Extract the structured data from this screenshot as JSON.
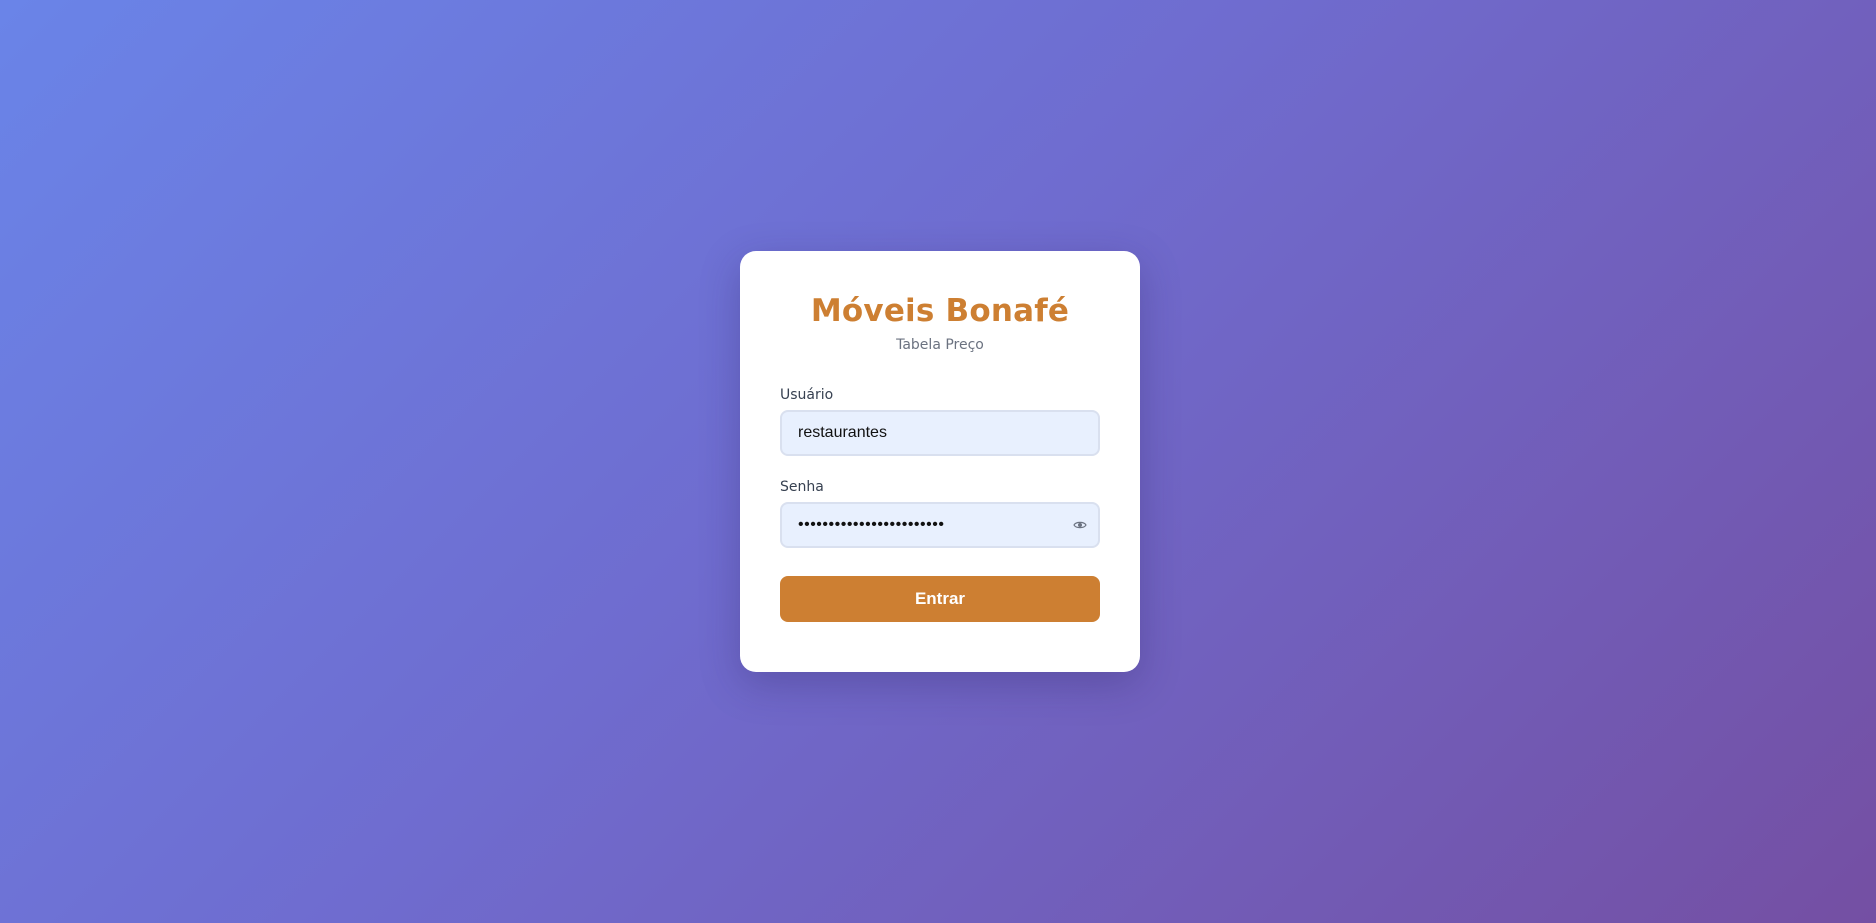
{
  "login": {
    "title": "Móveis Bonafé",
    "subtitle": "Tabela Preço",
    "username": {
      "label": "Usuário",
      "value": "restaurantes"
    },
    "password": {
      "label": "Senha",
      "value": "restaurantes12345678abcd",
      "toggle_icon": "eye-icon"
    },
    "submit_label": "Entrar"
  },
  "colors": {
    "brand": "#cd7f32",
    "background_start": "#6a84e8",
    "background_end": "#744fa3",
    "input_background": "#e8f0fe"
  }
}
